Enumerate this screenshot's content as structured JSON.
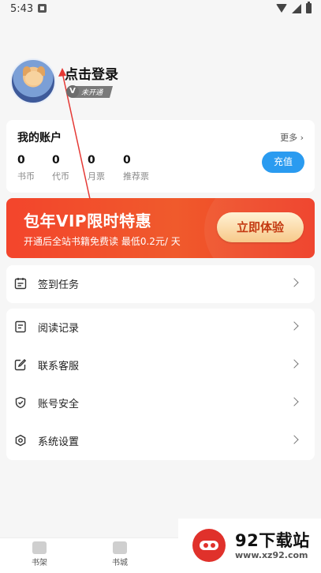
{
  "status_bar": {
    "time": "5:43"
  },
  "profile": {
    "login_text": "点击登录",
    "vip_status": "未开通",
    "vip_badge_letter": "V"
  },
  "account": {
    "title": "我的账户",
    "more": "更多",
    "stats": [
      {
        "value": "0",
        "label": "书币"
      },
      {
        "value": "0",
        "label": "代币"
      },
      {
        "value": "0",
        "label": "月票"
      },
      {
        "value": "0",
        "label": "推荐票"
      }
    ],
    "recharge": "充值"
  },
  "vip_banner": {
    "title": "包年VIP限时特惠",
    "subtitle": "开通后全站书籍免费读 最低0.2元/ 天",
    "cta": "立即体验"
  },
  "menu": {
    "checkin": "签到任务",
    "items": [
      "阅读记录",
      "联系客服",
      "账号安全",
      "系统设置"
    ]
  },
  "bottom_nav": {
    "tabs": [
      "书架",
      "书城"
    ]
  },
  "watermark": {
    "title": "92下载站",
    "url": "www.xz92.com"
  },
  "colors": {
    "accent": "#2a9bf0",
    "banner": "#f0492b",
    "cta_text": "#c43a12"
  }
}
